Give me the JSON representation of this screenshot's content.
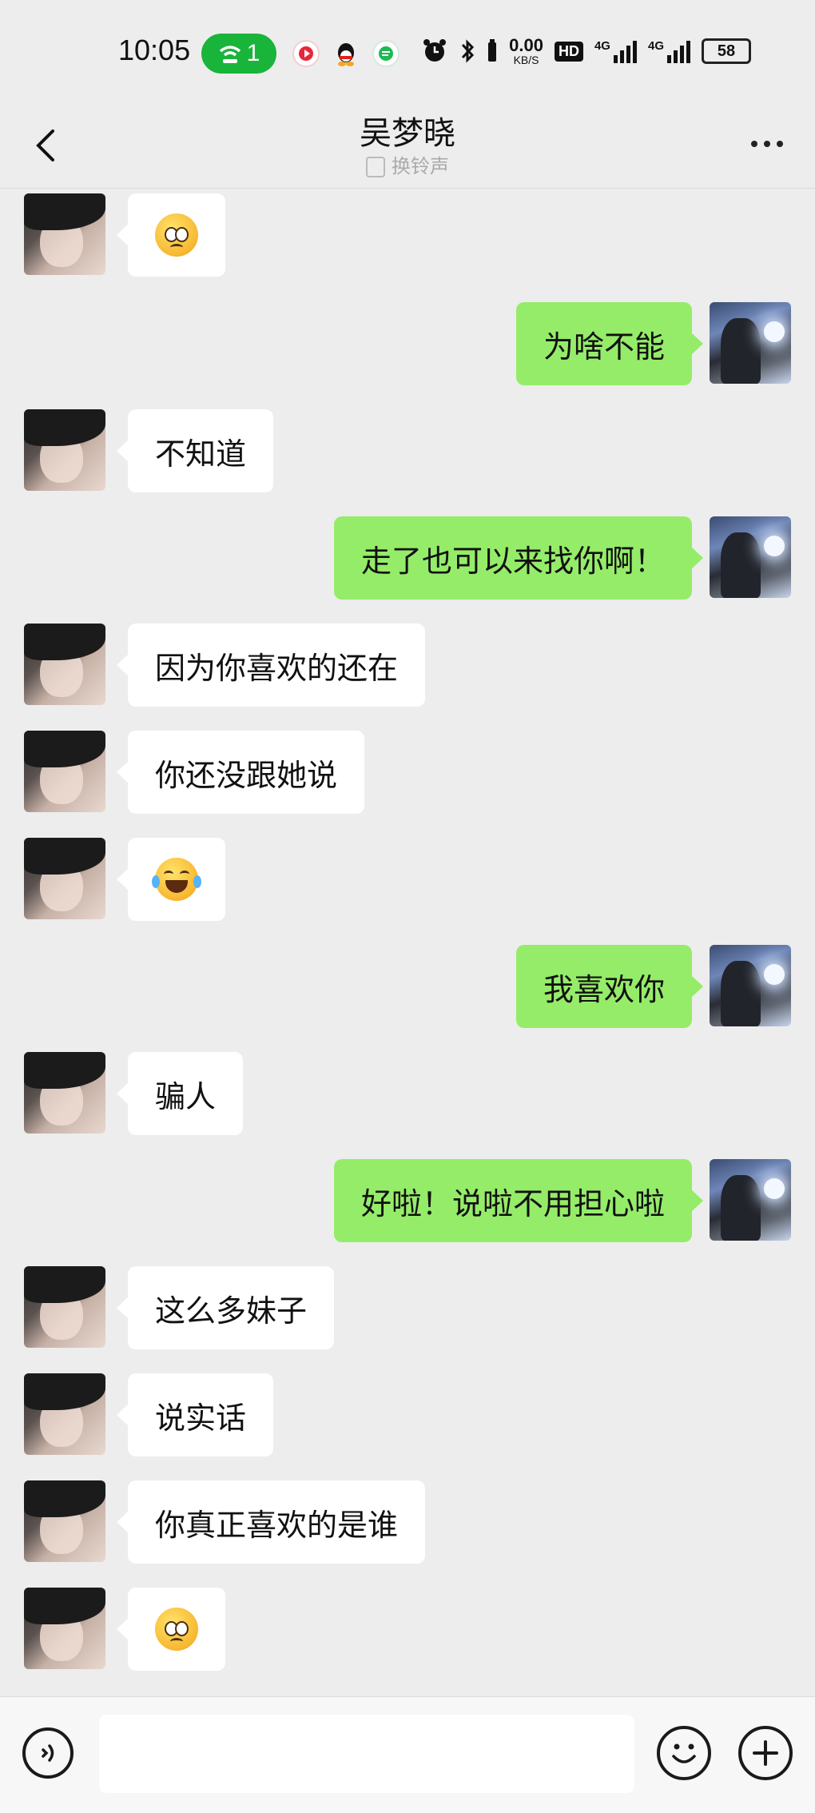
{
  "status_bar": {
    "time": "10:05",
    "wifi_count": "1",
    "network_speed_value": "0.00",
    "network_speed_unit": "KB/S",
    "hd_label": "HD",
    "network_1": "4G",
    "network_2": "4G",
    "battery": "58",
    "colors": {
      "wifi_pill": "#19b43a"
    }
  },
  "nav": {
    "title": "吴梦晓",
    "subtitle": "换铃声"
  },
  "messages": [
    {
      "from": "her",
      "type": "emoji",
      "emoji": "pleading-face"
    },
    {
      "from": "me",
      "type": "text",
      "text": "为啥不能"
    },
    {
      "from": "her",
      "type": "text",
      "text": "不知道"
    },
    {
      "from": "me",
      "type": "text",
      "text": "走了也可以来找你啊！"
    },
    {
      "from": "her",
      "type": "text",
      "text": "因为你喜欢的还在"
    },
    {
      "from": "her",
      "type": "text",
      "text": "你还没跟她说"
    },
    {
      "from": "her",
      "type": "emoji",
      "emoji": "tears-of-joy"
    },
    {
      "from": "me",
      "type": "text",
      "text": "我喜欢你"
    },
    {
      "from": "her",
      "type": "text",
      "text": "骗人"
    },
    {
      "from": "me",
      "type": "text",
      "text": "好啦！说啦不用担心啦"
    },
    {
      "from": "her",
      "type": "text",
      "text": "这么多妹子"
    },
    {
      "from": "her",
      "type": "text",
      "text": "说实话"
    },
    {
      "from": "her",
      "type": "text",
      "text": "你真正喜欢的是谁"
    },
    {
      "from": "her",
      "type": "emoji",
      "emoji": "pleading-face"
    }
  ],
  "input_bar": {
    "text_value": "",
    "voice_icon": "voice-icon",
    "emoji_icon": "emoji-icon",
    "plus_icon": "plus-icon"
  },
  "colors": {
    "background": "#ededed",
    "my_bubble": "#95ec69",
    "her_bubble": "#ffffff"
  }
}
